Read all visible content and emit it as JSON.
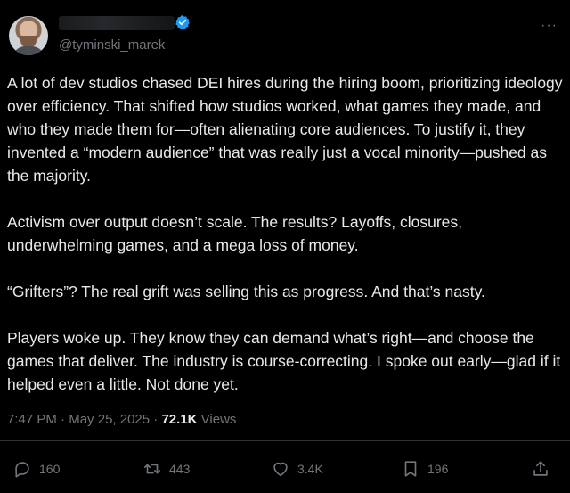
{
  "author": {
    "handle": "@tyminski_marek",
    "more_glyph": "···"
  },
  "tweet": {
    "paragraphs": [
      "A lot of dev studios chased DEI hires during the hiring boom, prioritizing ideology over efficiency. That shifted how studios worked, what games they made, and who they made them for—often alienating core audiences. To justify it, they invented a “modern audience” that was really just a vocal minority—pushed as the majority.",
      "Activism over output doesn’t scale. The results? Layoffs, closures, underwhelming games, and a mega loss of money.",
      "“Grifters”? The real grift was selling this as progress. And that’s nasty.",
      "Players woke up. They know they can demand what’s right—and choose the games that deliver. The industry is course-correcting. I spoke out early—glad if it helped even a little. Not done yet."
    ]
  },
  "meta": {
    "time": "7:47 PM",
    "separator": "·",
    "date": "May 25, 2025",
    "views_count": "72.1K",
    "views_label": "Views"
  },
  "actions": {
    "replies": "160",
    "reposts": "443",
    "likes": "3.4K",
    "bookmarks": "196"
  },
  "colors": {
    "background": "#000000",
    "text": "#e7e9ea",
    "muted": "#71767b",
    "verified": "#1d9bf0",
    "divider": "#2f3336"
  },
  "icons": [
    "verified-badge-icon",
    "more-icon",
    "reply-icon",
    "repost-icon",
    "like-icon",
    "bookmark-icon",
    "share-icon"
  ]
}
